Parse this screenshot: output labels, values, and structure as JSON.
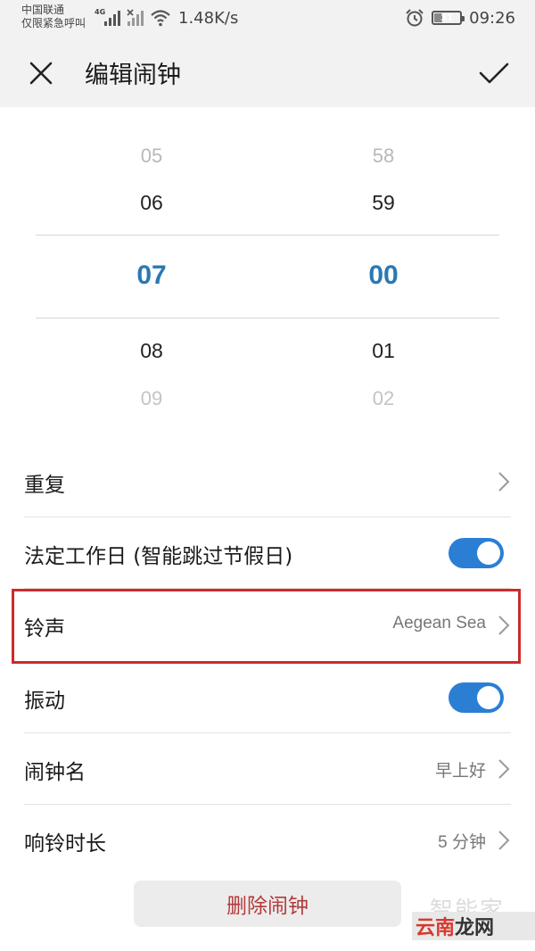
{
  "status_bar": {
    "carrier_line1": "中国联通",
    "carrier_line2": "仅限紧急呼叫",
    "network_type": "4G",
    "speed": "1.48K/s",
    "battery": "31",
    "battery_level_percent": 31,
    "time": "09:26"
  },
  "header": {
    "title": "编辑闹钟"
  },
  "time_picker": {
    "hours": [
      "05",
      "06",
      "07",
      "08",
      "09"
    ],
    "minutes": [
      "58",
      "59",
      "00",
      "01",
      "02"
    ],
    "selected_hour": "07",
    "selected_minute": "00",
    "accent_color": "#2a78b3"
  },
  "settings": {
    "repeat": {
      "label": "重复"
    },
    "workday": {
      "label": "法定工作日 (智能跳过节假日)",
      "enabled": true
    },
    "ringtone": {
      "label": "铃声",
      "value": "Aegean Sea"
    },
    "vibrate": {
      "label": "振动",
      "enabled": true
    },
    "alarm_name": {
      "label": "闹钟名",
      "value": "早上好"
    },
    "ring_duration": {
      "label": "响铃时长",
      "value": "5 分钟"
    }
  },
  "actions": {
    "delete_label": "删除闹钟"
  },
  "watermark": {
    "top": "智能家",
    "bottom_a": "云南",
    "bottom_b": "龙网"
  },
  "colors": {
    "toggle_on": "#2a7fd4",
    "highlight": "#cc2b2b",
    "delete_text": "#b33a3a"
  }
}
